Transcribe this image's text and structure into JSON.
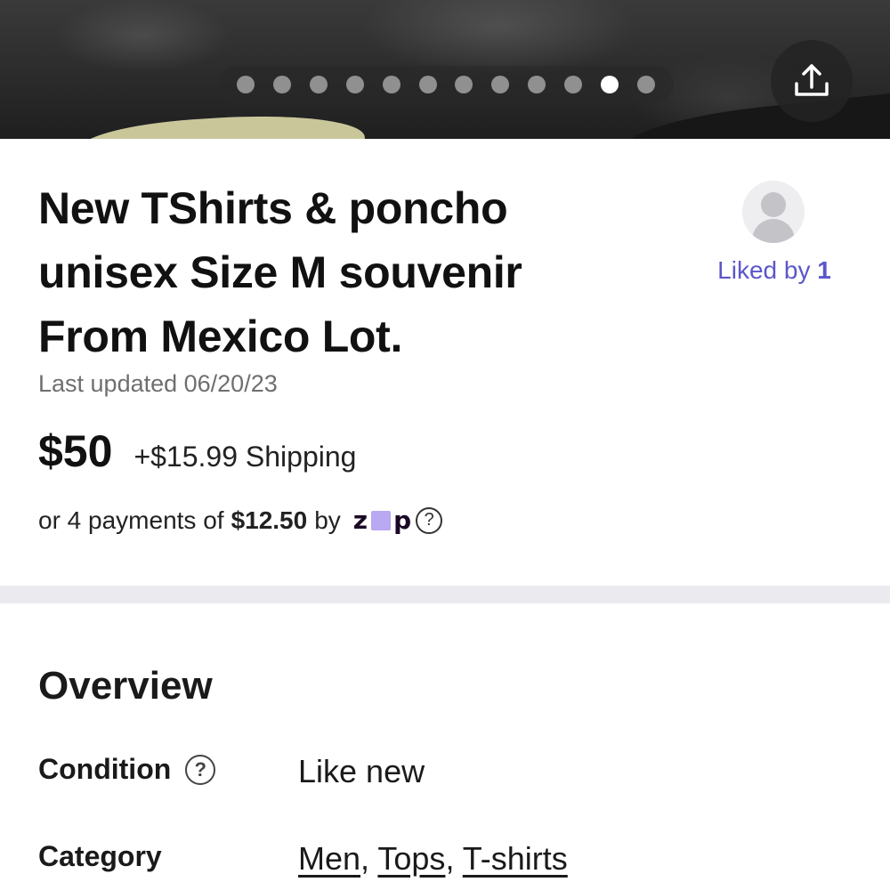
{
  "carousel": {
    "dot_count": 12,
    "active_index": 10,
    "share_icon": "share-upload-icon"
  },
  "listing": {
    "title": "New TShirts & poncho\nunisex Size M souvenir\nFrom Mexico  Lot.",
    "last_updated": "Last updated 06/20/23",
    "price": "$50",
    "shipping": "+$15.99 Shipping",
    "installments": {
      "prefix": "or 4 payments of",
      "amount": "$12.50",
      "by": "by",
      "provider_logo_text_left": "z",
      "provider_logo_text_right": "p",
      "help_icon": "question-circle-icon"
    }
  },
  "seller": {
    "avatar_icon": "default-avatar-icon",
    "liked_by_label": "Liked by",
    "liked_by_count": "1"
  },
  "overview": {
    "heading": "Overview",
    "condition_label": "Condition",
    "condition_value": "Like new",
    "category_label": "Category",
    "category_links": [
      "Men",
      "Tops",
      "T-shirts"
    ]
  },
  "colors": {
    "accent": "#5b57c9",
    "zip_purple": "#b9a8f2",
    "divider": "#ebebef"
  }
}
